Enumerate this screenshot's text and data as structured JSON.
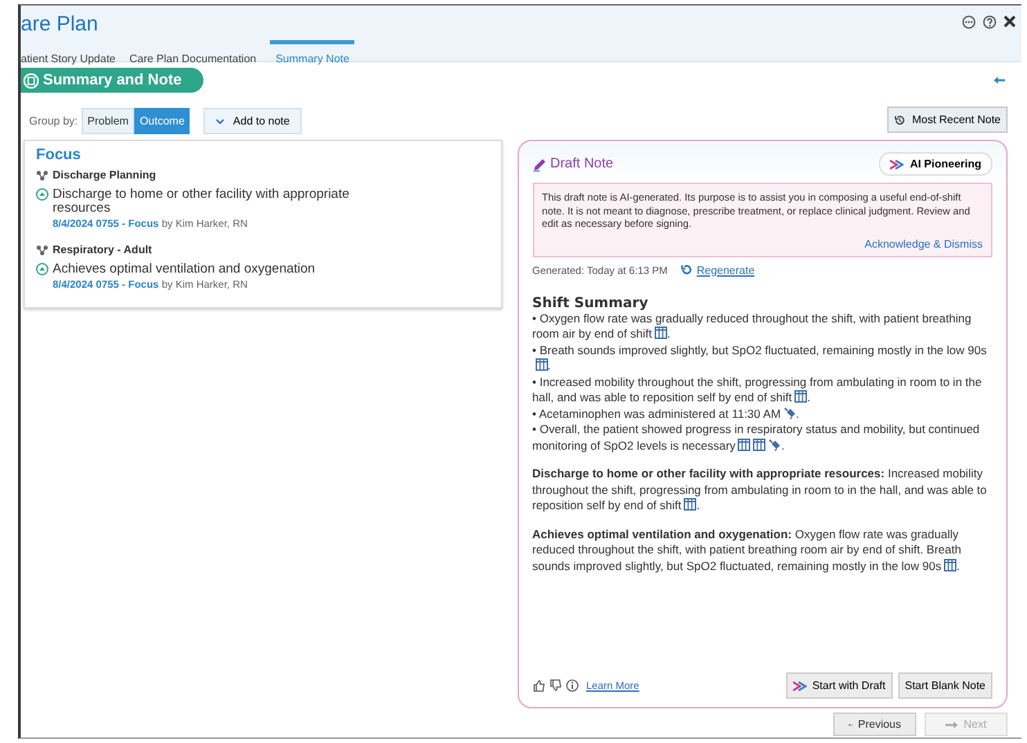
{
  "window": {
    "title": "are Plan"
  },
  "tabs": [
    {
      "label": "atient Story Update",
      "selected": false
    },
    {
      "label": "Care Plan Documentation",
      "selected": false
    },
    {
      "label": "Summary Note",
      "selected": true
    }
  ],
  "section_title": "Summary and Note",
  "group_by": {
    "label": "Group by:",
    "options": [
      {
        "label": "Problem",
        "selected": false
      },
      {
        "label": "Outcome",
        "selected": true
      }
    ]
  },
  "add_to_note": "Add to note",
  "most_recent_note": "Most Recent Note",
  "outcomes": {
    "heading": "Focus",
    "problems": [
      {
        "name": "Discharge Planning",
        "outcomes": [
          {
            "text": "Discharge to home or other facility with appropriate resources",
            "date": "8/4/2024 0755 - Focus",
            "author": "by Kim Harker, RN"
          }
        ]
      },
      {
        "name": "Respiratory - Adult",
        "outcomes": [
          {
            "text": "Achieves optimal ventilation and oxygenation",
            "date": "8/4/2024 0755 - Focus",
            "author": "by Kim Harker, RN"
          }
        ]
      }
    ]
  },
  "draft_note": {
    "title": "Draft Note",
    "badge": "AI Pioneering",
    "disclaimer": "This draft note is AI-generated. Its purpose is to assist you in composing a useful end-of-shift note. It is not meant to diagnose, prescribe treatment, or replace clinical judgment. Review and edit as necessary before signing.",
    "dismiss": "Acknowledge & Dismiss",
    "generated": "Generated: Today at 6:13 PM",
    "regenerate": "Regenerate",
    "summary_heading": "Shift Summary",
    "bullets": [
      {
        "text": "• Oxygen flow rate was gradually reduced throughout the shift, with patient breathing room air by end of shift",
        "sources": [
          {
            "kind": "flowsheet"
          }
        ],
        "tail": "."
      },
      {
        "text": "• Breath sounds improved slightly, but SpO2 fluctuated, remaining mostly in the low 90s",
        "sources": [
          {
            "kind": "flowsheet"
          }
        ],
        "tail": "."
      },
      {
        "text": "• Increased mobility throughout the shift, progressing from ambulating in room to in the hall, and was able to reposition self by end of shift",
        "sources": [
          {
            "kind": "flowsheet"
          }
        ],
        "tail": "."
      },
      {
        "text": "• Acetaminophen was administered at 11:30 AM",
        "sources": [
          {
            "kind": "medication"
          }
        ],
        "tail": "."
      },
      {
        "text": "• Overall, the patient showed progress in respiratory status and mobility, but continued monitoring of SpO2 levels is necessary",
        "sources": [
          {
            "kind": "flowsheet"
          },
          {
            "kind": "flowsheet"
          },
          {
            "kind": "medication"
          }
        ],
        "tail": "."
      }
    ],
    "paragraphs": [
      {
        "text": "**Discharge to home or other facility with appropriate resources:** Increased mobility throughout the shift, progressing from ambulating in room to in the hall, and was able to reposition self by end of shift",
        "sources": [
          {
            "kind": "flowsheet"
          }
        ],
        "tail": "."
      },
      {
        "text": "**Achieves optimal ventilation and oxygenation:** Oxygen flow rate was gradually reduced throughout the shift, with patient breathing room air by end of shift. Breath sounds improved slightly, but SpO2 fluctuated, remaining mostly in the low 90s",
        "sources": [
          {
            "kind": "flowsheet"
          }
        ],
        "tail": "."
      }
    ],
    "learn_more": "Learn More",
    "buttons": [
      {
        "label": "Start with Draft",
        "kind": "ai"
      },
      {
        "label": "Start Blank Note",
        "kind": "plain"
      }
    ]
  },
  "navigation": [
    {
      "label": "Previous",
      "kind": "previous",
      "disabled": false
    },
    {
      "label": "Next",
      "kind": "next",
      "disabled": true
    }
  ]
}
